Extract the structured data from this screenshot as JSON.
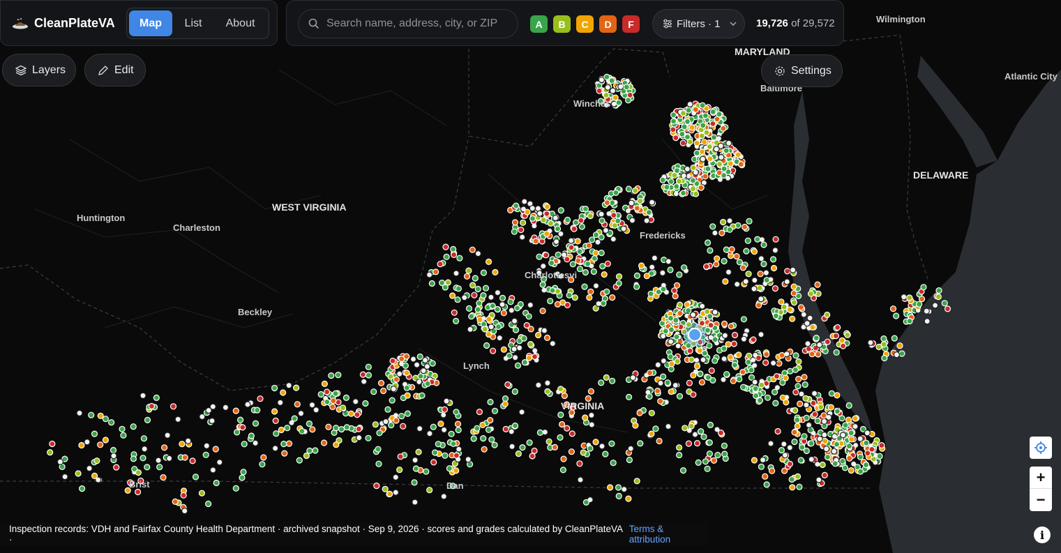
{
  "app": {
    "name": "CleanPlateVA"
  },
  "tabs": [
    {
      "label": "Map",
      "active": true
    },
    {
      "label": "List",
      "active": false
    },
    {
      "label": "About",
      "active": false
    }
  ],
  "search": {
    "placeholder": "Search name, address, city, or ZIP",
    "value": ""
  },
  "grades": [
    {
      "label": "A",
      "color": "#3aa44a"
    },
    {
      "label": "B",
      "color": "#98bf1c"
    },
    {
      "label": "C",
      "color": "#f0a500"
    },
    {
      "label": "D",
      "color": "#e36414"
    },
    {
      "label": "F",
      "color": "#c92a2a"
    }
  ],
  "filters": {
    "label": "Filters · 1"
  },
  "count": {
    "shown": "19,726",
    "of_label": "of 29,572"
  },
  "toolbar": {
    "layers_label": "Layers",
    "edit_label": "Edit",
    "settings_label": "Settings"
  },
  "map_labels": {
    "wilmington": "Wilmington",
    "maryland": "MARYLAND",
    "atlantic_city": "Atlantic City",
    "baltimore": "Baltimore",
    "delaware": "DELAWARE",
    "west_virginia": "WEST VIRGINIA",
    "huntington": "Huntington",
    "charleston": "Charleston",
    "beckley": "Beckley",
    "winchester": "Winches",
    "fredericksburg": "Fredericks",
    "charlottesville": "Charlottesvi",
    "lynchburg": "Lynch",
    "virginia": "VIRGINIA",
    "bristol": "Brist",
    "danville": "Dan"
  },
  "footer": {
    "text": "Inspection records: VDH and Fairfax County Health Department · archived snapshot · Sep 9, 2026 · scores and grades calculated by CleanPlateVA ·",
    "link": "Terms & attribution"
  },
  "controls": {
    "zoom_in": "+",
    "zoom_out": "−",
    "info": "i"
  },
  "colors": {
    "accent": "#3f86e6",
    "unrated": "#e8e8e8",
    "selected": "#5aa0f0"
  }
}
